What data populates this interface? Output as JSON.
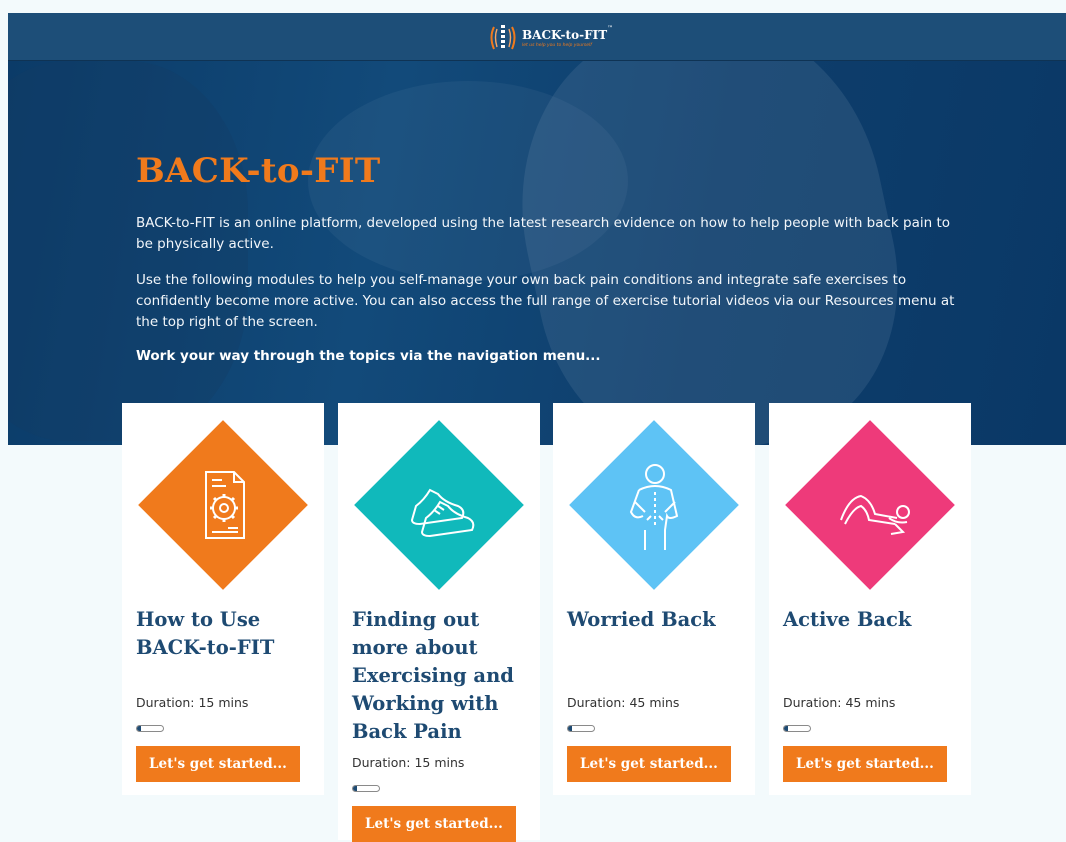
{
  "header": {
    "logo_name": "BACK-to-FIT",
    "logo_tm": "™",
    "logo_tagline": "let us help you to help yourself"
  },
  "hero": {
    "title": "BACK-to-FIT",
    "paragraph1": "BACK-to-FIT is an online platform, developed using the latest research evidence on how to help people with back pain to be physically active.",
    "paragraph2": "Use the following modules to help you self-manage your own back pain conditions and integrate safe exercises to confidently become more active. You can also access the full range of exercise tutorial videos via our Resources menu at the top right of the screen.",
    "instruction": "Work your way through the topics via the navigation menu..."
  },
  "modules": [
    {
      "title": "How to Use BACK-to-FIT",
      "duration": "Duration: 15 mins",
      "button": "Let's get started...",
      "color": "#f07a1c",
      "icon": "document-gear-icon",
      "progress": 0.15
    },
    {
      "title": "Finding out more about Exercising and Working with Back Pain",
      "duration": "Duration: 15 mins",
      "button": "Let's get started...",
      "color": "#10b9bb",
      "icon": "sneakers-icon",
      "progress": 0.15
    },
    {
      "title": "Worried Back",
      "duration": "Duration: 45 mins",
      "button": "Let's get started...",
      "color": "#5ec3f5",
      "icon": "back-pain-icon",
      "progress": 0.15
    },
    {
      "title": "Active Back",
      "duration": "Duration: 45 mins",
      "button": "Let's get started...",
      "color": "#ee3a7a",
      "icon": "stretching-person-icon",
      "progress": 0.15
    }
  ]
}
